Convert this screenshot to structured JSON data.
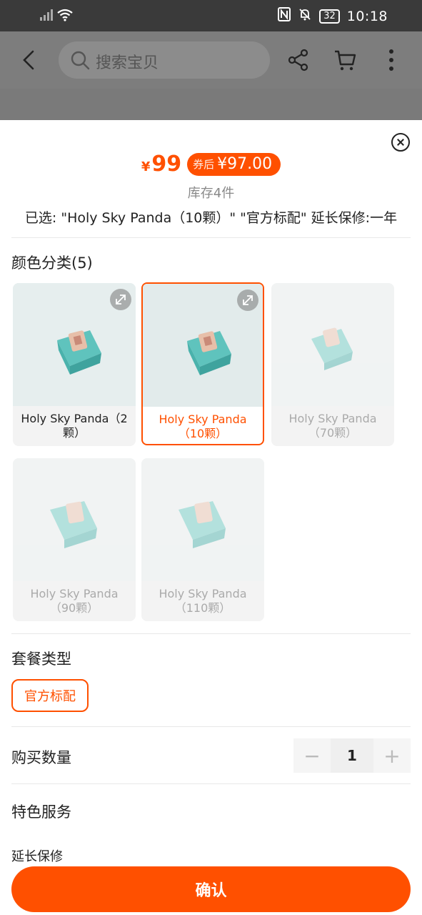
{
  "status_bar": {
    "battery": "32",
    "time": "10:18"
  },
  "header": {
    "search_placeholder": "搜索宝贝"
  },
  "sheet": {
    "price_currency": "¥",
    "price": "99",
    "after_label": "券后",
    "after_price": "¥97.00",
    "stock": "库存4件",
    "selected": "已选: \"Holy Sky Panda（10颗）\" \"官方标配\" 延长保修:一年",
    "color_section_title": "颜色分类(5)",
    "color_options": [
      {
        "label": "Holy Sky Panda（2颗）",
        "state": "available"
      },
      {
        "label": "Holy Sky Panda（10颗）",
        "state": "selected"
      },
      {
        "label": "Holy Sky Panda（70颗）",
        "state": "disabled"
      },
      {
        "label": "Holy Sky Panda（90颗）",
        "state": "disabled"
      },
      {
        "label": "Holy Sky Panda（110颗）",
        "state": "disabled"
      }
    ],
    "package_section_title": "套餐类型",
    "package_option": "官方标配",
    "quantity_label": "购买数量",
    "quantity_minus": "−",
    "quantity_value": "1",
    "quantity_plus": "+",
    "services_title": "特色服务",
    "warranty_label": "延长保修",
    "confirm_label": "确认"
  },
  "colors": {
    "accent": "#ff5000",
    "status_bar_bg": "#3a3a3a",
    "overlay_bg": "#7d7d7d"
  }
}
